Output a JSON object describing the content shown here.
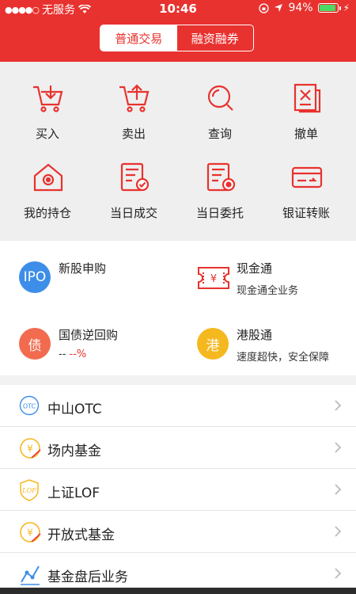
{
  "status": {
    "carrier": "无服务",
    "time": "10:46",
    "battery": "94%",
    "battery_level": 0.94
  },
  "tabs": {
    "normal": "普通交易",
    "margin": "融资融券"
  },
  "grid": [
    {
      "label": "买入",
      "icon": "cart-in-icon"
    },
    {
      "label": "卖出",
      "icon": "cart-out-icon"
    },
    {
      "label": "查询",
      "icon": "search-icon"
    },
    {
      "label": "撤单",
      "icon": "cancel-order-icon"
    },
    {
      "label": "我的持仓",
      "icon": "holdings-icon"
    },
    {
      "label": "当日成交",
      "icon": "deal-icon"
    },
    {
      "label": "当日委托",
      "icon": "entrust-icon"
    },
    {
      "label": "银证转账",
      "icon": "transfer-icon"
    }
  ],
  "services": {
    "ipo": {
      "badge": "IPO",
      "title": "新股申购",
      "color": "#3d8ee8"
    },
    "cash": {
      "title": "现金通",
      "subtitle": "现金通全业务"
    },
    "repo": {
      "badge": "债",
      "title": "国债逆回购",
      "value_prefix": "-- ",
      "value": "--%",
      "color": "#f26b4f"
    },
    "hk": {
      "badge": "港",
      "title": "港股通",
      "subtitle": "速度超快，安全保障",
      "color": "#f5b81f"
    }
  },
  "list": [
    {
      "label": "中山OTC",
      "icon": "otc-icon"
    },
    {
      "label": "场内基金",
      "icon": "fund-icon"
    },
    {
      "label": "上证LOF",
      "icon": "lof-icon"
    },
    {
      "label": "开放式基金",
      "icon": "open-fund-icon"
    },
    {
      "label": "基金盘后业务",
      "icon": "after-hours-icon"
    }
  ]
}
